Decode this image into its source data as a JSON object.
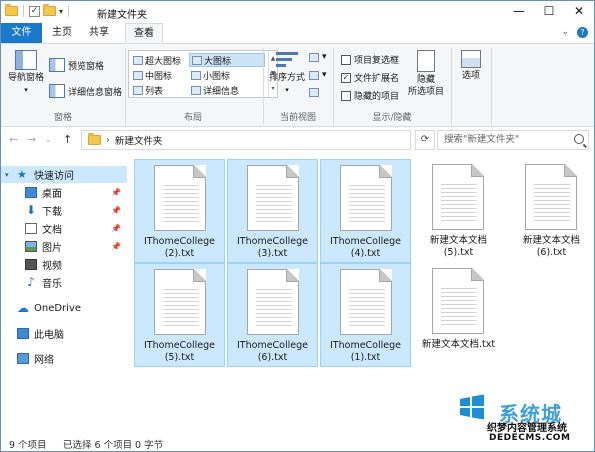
{
  "window": {
    "title": "新建文件夹",
    "controls": [
      "—",
      "☐",
      "✕"
    ]
  },
  "tabs": [
    {
      "label": "文件"
    },
    {
      "label": "主页"
    },
    {
      "label": "共享"
    },
    {
      "label": "查看"
    }
  ],
  "ribbon": {
    "pane": {
      "nav_pane_label": "导航窗格",
      "preview_pane_label": "预览窗格",
      "details_pane_label": "详细信息窗格",
      "group_label": "窗格"
    },
    "layout": {
      "items": [
        "超大图标",
        "大图标",
        "中图标",
        "小图标",
        "列表",
        "详细信息"
      ],
      "selected": "大图标",
      "group_label": "布局"
    },
    "current_view": {
      "sort_label": "排序方式",
      "group_label": "当前视图"
    },
    "show_hide": {
      "item_checkboxes_label": "项目复选框",
      "extensions_label": "文件扩展名",
      "extensions_checked": true,
      "hidden_items_label": "隐藏的项目",
      "hide_selected_label_1": "隐藏",
      "hide_selected_label_2": "所选项目",
      "group_label": "显示/隐藏"
    },
    "options_label": "选项"
  },
  "address": {
    "path": "新建文件夹",
    "search_placeholder": "搜索\"新建文件夹\""
  },
  "nav": {
    "quick_access": "快速访问",
    "items": [
      {
        "label": "桌面",
        "pinned": true
      },
      {
        "label": "下载",
        "pinned": true
      },
      {
        "label": "文档",
        "pinned": true
      },
      {
        "label": "图片",
        "pinned": true
      },
      {
        "label": "视频",
        "pinned": false
      },
      {
        "label": "音乐",
        "pinned": false
      }
    ],
    "onedrive": "OneDrive",
    "this_pc": "此电脑",
    "network": "网络"
  },
  "files": [
    {
      "line1": "IThomeCollege",
      "line2": "(2).txt",
      "selected": true
    },
    {
      "line1": "IThomeCollege",
      "line2": "(3).txt",
      "selected": true
    },
    {
      "line1": "IThomeCollege",
      "line2": "(4).txt",
      "selected": true
    },
    {
      "line1": "新建文本文档",
      "line2": "(5).txt",
      "selected": false
    },
    {
      "line1": "新建文本文档",
      "line2": "(6).txt",
      "selected": false
    },
    {
      "line1": "IThomeCollege",
      "line2": "(5).txt",
      "selected": true
    },
    {
      "line1": "IThomeCollege",
      "line2": "(6).txt",
      "selected": true
    },
    {
      "line1": "IThomeCollege",
      "line2": "(1).txt",
      "selected": true
    },
    {
      "line1": "新建文本文档.txt",
      "line2": "",
      "selected": false
    }
  ],
  "status": {
    "item_count": "9 个项目",
    "selected_info": "已选择 6 个项目",
    "size": "0 字节"
  },
  "watermark": {
    "brand": "系统城",
    "sub1": "织梦内容管理系统",
    "sub2": "DEDECMS.COM"
  },
  "colors": {
    "accent": "#1979ca",
    "selection": "#cce8ff",
    "selection_border": "#99d1ff",
    "folder": "#f3c74b"
  }
}
